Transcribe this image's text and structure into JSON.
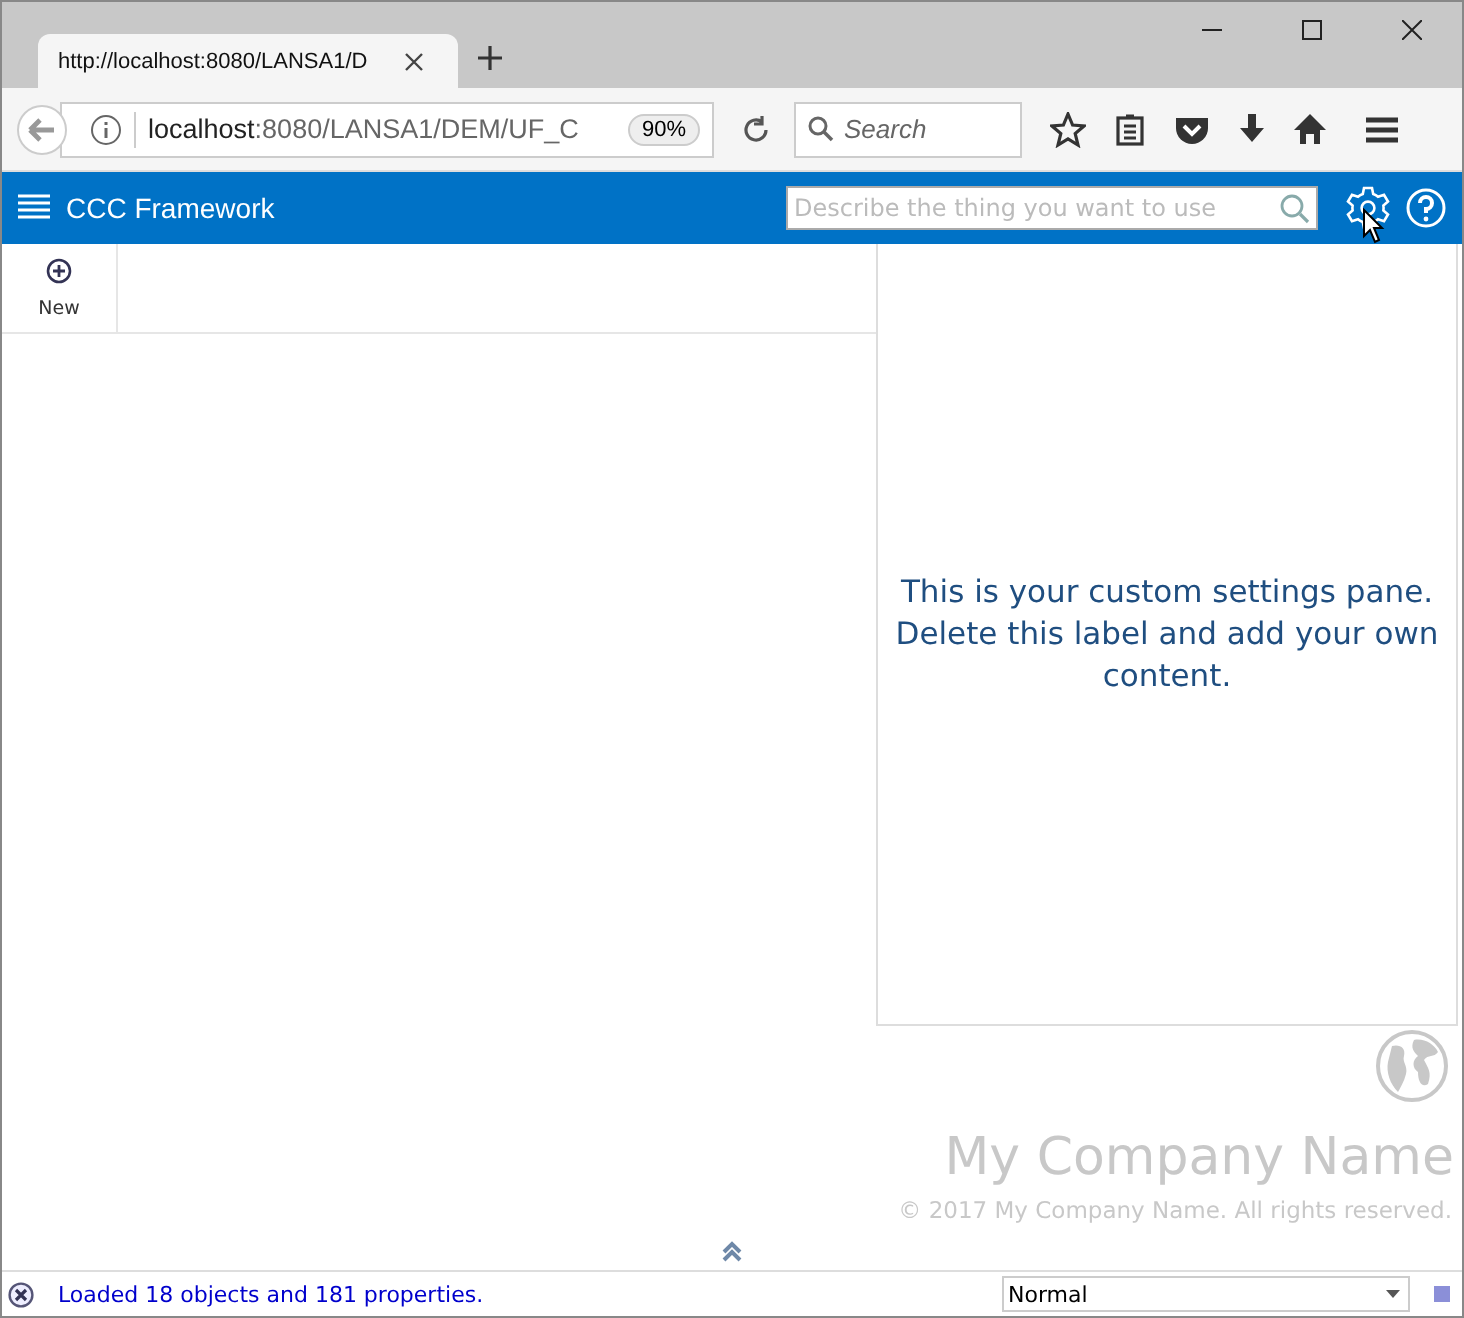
{
  "browser": {
    "tab_title": "http://localhost:8080/LANSA1/D",
    "url_host": "localhost",
    "url_path": ":8080/LANSA1/DEM/UF_C",
    "zoom": "90%",
    "search_placeholder": "Search"
  },
  "app": {
    "title": "CCC Framework",
    "search_placeholder": "Describe the thing you want to use"
  },
  "toolbar": [
    {
      "label": "New"
    }
  ],
  "settings_pane": {
    "text": "This is your custom settings pane. Delete this label and add your own content."
  },
  "footer": {
    "company": "My Company Name",
    "copyright": "© 2017 My Company Name. All rights reserved."
  },
  "status_bar": {
    "message": "Loaded 18 objects and 181 properties.",
    "mode": "Normal"
  }
}
